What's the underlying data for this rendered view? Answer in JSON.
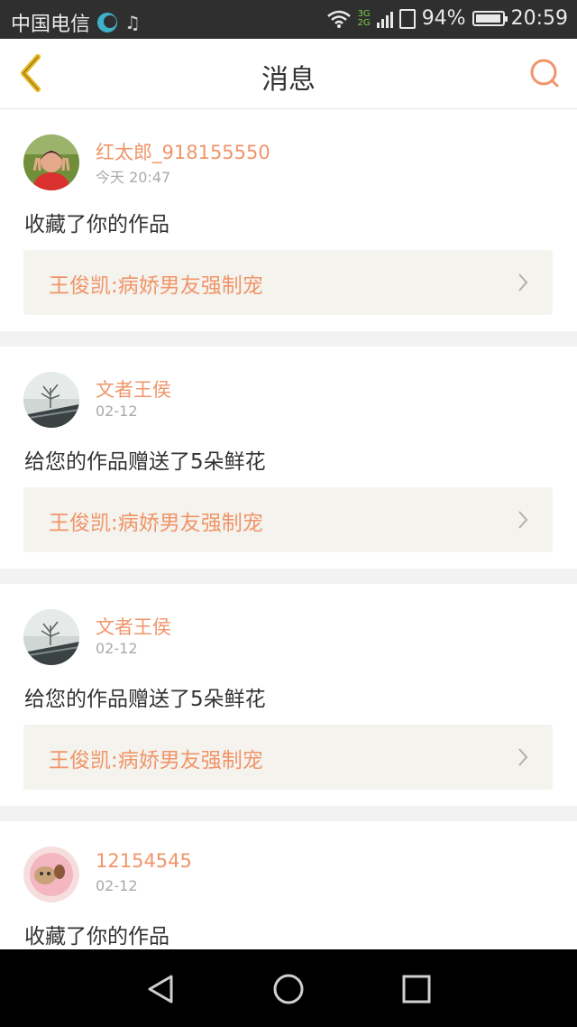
{
  "status_bar": {
    "carrier": "中国电信",
    "network_types": [
      "3G",
      "2G"
    ],
    "battery_percent": "94%",
    "time": "20:59",
    "icons": [
      "moon-icon",
      "music-icon",
      "wifi-icon",
      "signal-icon",
      "sim-icon",
      "battery-icon"
    ]
  },
  "header": {
    "title": "消息",
    "back_icon": "chevron-left-icon",
    "search_icon": "search-icon",
    "accent_color": "#f0956a",
    "back_color": "#e8b51f"
  },
  "messages": [
    {
      "user": "红太郎_918155550",
      "time": "今天 20:47",
      "action": "收藏了你的作品",
      "work_title": "王俊凯:病娇男友强制宠",
      "avatar": "child-photo-avatar"
    },
    {
      "user": "文者王侯",
      "time": "02-12",
      "action": "给您的作品赠送了5朵鲜花",
      "work_title": "王俊凯:病娇男友强制宠",
      "avatar": "landscape-photo-avatar"
    },
    {
      "user": "文者王侯",
      "time": "02-12",
      "action": "给您的作品赠送了5朵鲜花",
      "work_title": "王俊凯:病娇男友强制宠",
      "avatar": "landscape-photo-avatar"
    },
    {
      "user": "12154545",
      "time": "02-12",
      "action": "收藏了你的作品",
      "work_title": "",
      "avatar": "cartoon-sheep-avatar"
    }
  ],
  "system_nav": {
    "icons": [
      "back-triangle-icon",
      "home-circle-icon",
      "recents-square-icon"
    ]
  }
}
